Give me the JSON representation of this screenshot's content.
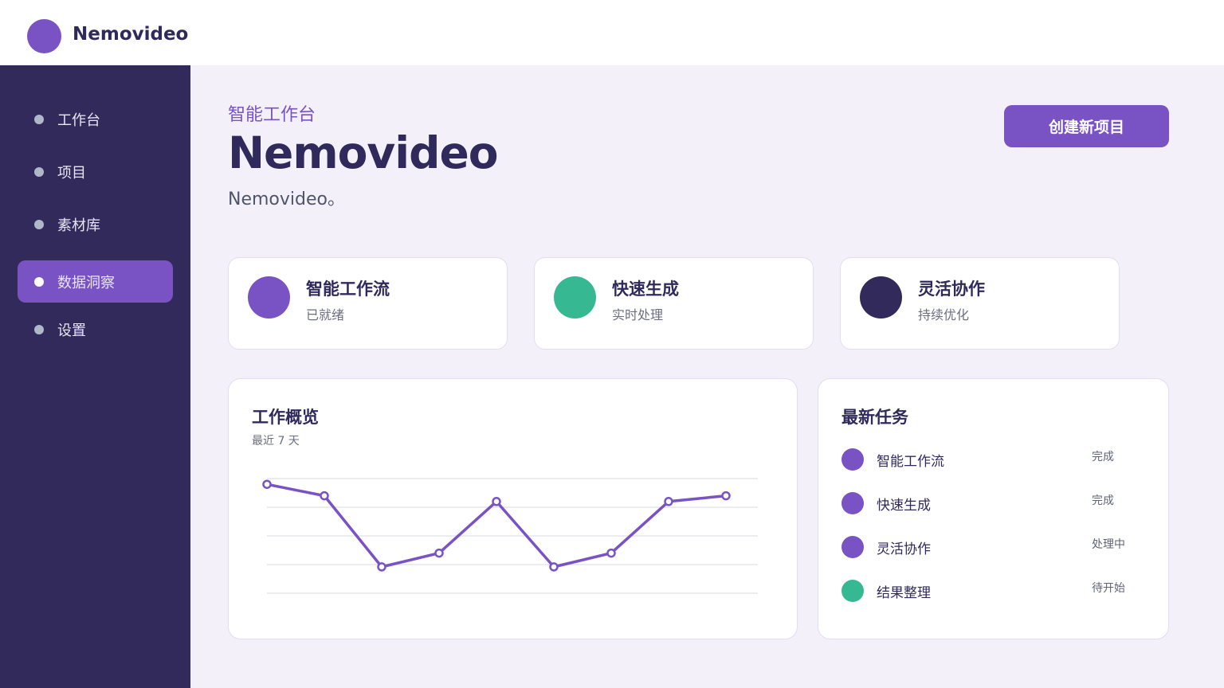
{
  "app": {
    "brand": "Nemovideo"
  },
  "colors": {
    "accent": "#7952c4",
    "green": "#36b993",
    "navy": "#332a5c",
    "sidebar": "#332a5c"
  },
  "sidebar": {
    "items": [
      {
        "label": "工作台",
        "active": false
      },
      {
        "label": "项目",
        "active": false
      },
      {
        "label": "素材库",
        "active": false
      },
      {
        "label": "数据洞察",
        "active": true
      },
      {
        "label": "设置",
        "active": false
      }
    ]
  },
  "header": {
    "eyebrow": "智能工作台",
    "title": "Nemovideo",
    "subtitle": "Nemovideo。",
    "create_label": "创建新项目"
  },
  "features": [
    {
      "title": "智能工作流",
      "subtitle": "已就绪",
      "color": "#7952c4"
    },
    {
      "title": "快速生成",
      "subtitle": "实时处理",
      "color": "#36b993"
    },
    {
      "title": "灵活协作",
      "subtitle": "持续优化",
      "color": "#332a5c"
    }
  ],
  "overview": {
    "title": "工作概览",
    "subtitle": "最近 7 天"
  },
  "chart_data": {
    "type": "line",
    "title": "工作概览",
    "subtitle": "最近 7 天",
    "xlabel": "",
    "ylabel": "",
    "x": [
      1,
      2,
      3,
      4,
      5,
      6,
      7,
      8,
      9
    ],
    "ylim": [
      0,
      100
    ],
    "grid": true,
    "series": [
      {
        "values": [
          95,
          85,
          23,
          35,
          80,
          23,
          35,
          80,
          85
        ],
        "color": "#7952c4"
      }
    ]
  },
  "tasks": {
    "title": "最新任务",
    "items": [
      {
        "name": "智能工作流",
        "status": "完成",
        "color": "#7952c4"
      },
      {
        "name": "快速生成",
        "status": "完成",
        "color": "#7952c4"
      },
      {
        "name": "灵活协作",
        "status": "处理中",
        "color": "#7952c4"
      },
      {
        "name": "结果整理",
        "status": "待开始",
        "color": "#36b993"
      }
    ]
  }
}
